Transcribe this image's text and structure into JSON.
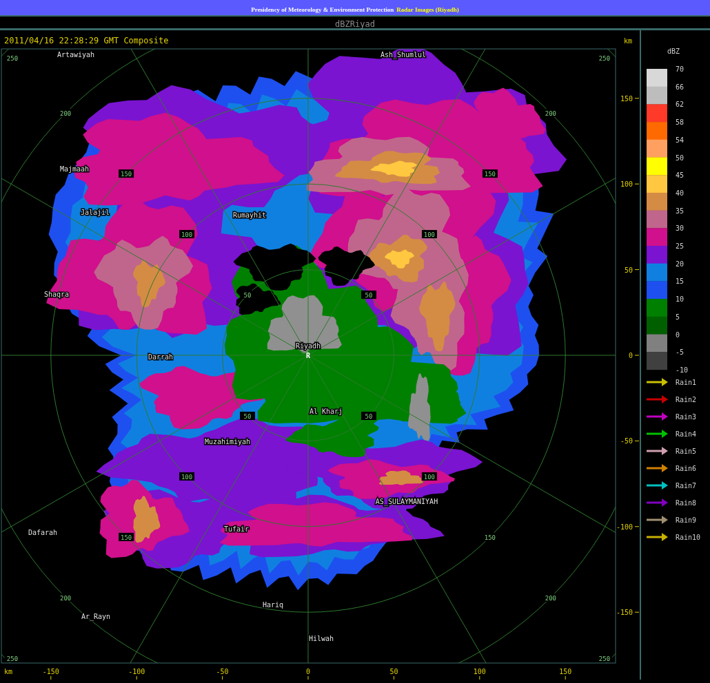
{
  "header": {
    "title": "Presidency of Meteorology & Environment Protection",
    "subtitle": "Radar Images (Riyadh)"
  },
  "product": "dBZRiyad",
  "map": {
    "timestamp": "2011/04/16 22:28:29 GMT Composite",
    "x_axis": {
      "unit": "km",
      "ticks": [
        "-150",
        "-100",
        "-50",
        "0",
        "50",
        "100",
        "150"
      ]
    },
    "y_axis": {
      "unit": "km",
      "ticks": [
        "150",
        "100",
        "50",
        "0",
        "-50",
        "-100",
        "-150"
      ]
    },
    "range_rings": [
      {
        "labels": [
          "50",
          "50",
          "50",
          "50"
        ]
      },
      {
        "labels": [
          "100",
          "100",
          "100",
          "100"
        ]
      },
      {
        "labels": [
          "150",
          "150",
          "150",
          "150"
        ]
      },
      {
        "labels": [
          "200",
          "200",
          "200",
          "200"
        ]
      },
      {
        "labels": [
          "250",
          "250",
          "250",
          "250"
        ]
      }
    ],
    "center_marker": "R",
    "places": [
      {
        "name": "Artawiyah"
      },
      {
        "name": "Ash_Shumlul"
      },
      {
        "name": "Majmaah"
      },
      {
        "name": "Jalajil"
      },
      {
        "name": "Rumayhit"
      },
      {
        "name": "Shaqra"
      },
      {
        "name": "Riyadh"
      },
      {
        "name": "Darrah"
      },
      {
        "name": "Al Kharj"
      },
      {
        "name": "Muzahimiyah"
      },
      {
        "name": "AS_SULAYMANIYAH"
      },
      {
        "name": "Tufair"
      },
      {
        "name": "Dafarah"
      },
      {
        "name": "Hariq"
      },
      {
        "name": "Ar_Rayn"
      },
      {
        "name": "Hilwah"
      }
    ]
  },
  "legend": {
    "unit": "dBZ",
    "bands": [
      {
        "color": "#d8d8d8"
      },
      {
        "color": "#bdbdbd"
      },
      {
        "color": "#ff3a28"
      },
      {
        "color": "#ff6a00"
      },
      {
        "color": "#ffa060"
      },
      {
        "color": "#ffff00"
      },
      {
        "color": "#ffc840"
      },
      {
        "color": "#d48c44"
      },
      {
        "color": "#c0668c"
      },
      {
        "color": "#d0108c"
      },
      {
        "color": "#7a14d0"
      },
      {
        "color": "#1080e0"
      },
      {
        "color": "#1e50f0"
      },
      {
        "color": "#008000"
      },
      {
        "color": "#006000"
      },
      {
        "color": "#808080"
      },
      {
        "color": "#404040"
      }
    ],
    "values": [
      "70",
      "66",
      "62",
      "58",
      "54",
      "50",
      "45",
      "40",
      "35",
      "30",
      "25",
      "20",
      "15",
      "10",
      "5",
      "0",
      "-5",
      "-10"
    ],
    "tracks": [
      {
        "label": "Rain1",
        "color": "#c8c000"
      },
      {
        "label": "Rain2",
        "color": "#c80000"
      },
      {
        "label": "Rain3",
        "color": "#c000c0"
      },
      {
        "label": "Rain4",
        "color": "#00c000"
      },
      {
        "label": "Rain5",
        "color": "#d0a0b0"
      },
      {
        "label": "Rain6",
        "color": "#d08000"
      },
      {
        "label": "Rain7",
        "color": "#00c0c0"
      },
      {
        "label": "Rain8",
        "color": "#8000c0"
      },
      {
        "label": "Rain9",
        "color": "#a09070"
      },
      {
        "label": "Rain10",
        "color": "#c8b000"
      }
    ]
  }
}
